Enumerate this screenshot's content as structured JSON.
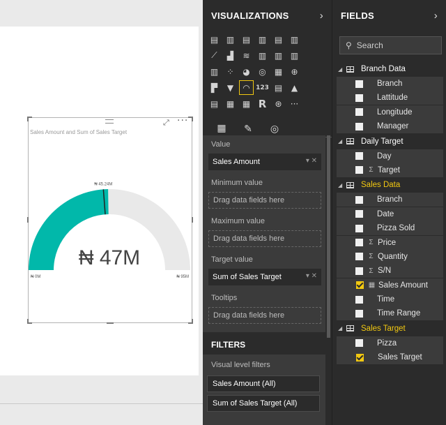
{
  "visual": {
    "title": "Sales Amount and Sum of Sales Target",
    "focus_icon": "focus-mode-icon",
    "more_icon": "more-options-icon"
  },
  "chart_data": {
    "type": "gauge",
    "value": 47,
    "value_label": "₦ 47M",
    "min": 0,
    "max": 95,
    "min_label": "₦ 0M",
    "max_label": "₦ 95M",
    "target": 45.24,
    "target_label": "₦ 45.24M",
    "fill_color": "#01b8aa",
    "track_color": "#e9e9e9",
    "target_color": "#222222"
  },
  "viz_pane": {
    "title": "VISUALIZATIONS",
    "chevron": "›",
    "icons": [
      "stacked-bar-icon",
      "stacked-column-icon",
      "clustered-bar-icon",
      "clustered-column-icon",
      "100-bar-icon",
      "100-column-icon",
      "line-chart-icon",
      "area-chart-icon",
      "stacked-area-icon",
      "line-column-icon",
      "line-stacked-column-icon",
      "ribbon-chart-icon",
      "waterfall-icon",
      "scatter-icon",
      "pie-icon",
      "donut-icon",
      "treemap-icon",
      "map-icon",
      "filled-map-icon",
      "funnel-icon",
      "gauge-icon",
      "card-icon",
      "multi-row-card-icon",
      "kpi-icon",
      "slicer-icon",
      "table-icon",
      "matrix-icon",
      "r-visual-icon",
      "globe-icon",
      "more-visuals-icon"
    ],
    "glyphs": [
      "▤",
      "▥",
      "▤",
      "▥",
      "▤",
      "▥",
      "⟋",
      "▟",
      "≋",
      "▥",
      "▥",
      "▥",
      "▥",
      "⁘",
      "◕",
      "◎",
      "▦",
      "⊕",
      "▛",
      "▼",
      "◠",
      "123",
      "▤",
      "▲",
      "▤",
      "▦",
      "▦",
      "R",
      "⊛",
      "···"
    ],
    "selected_index": 20,
    "tabs": [
      "fields-tab-icon",
      "format-tab-icon",
      "analytics-tab-icon"
    ],
    "tab_glyphs": [
      "▦",
      "✎",
      "◎"
    ],
    "wells": {
      "value_label": "Value",
      "value_field": "Sales Amount",
      "min_label": "Minimum value",
      "min_placeholder": "Drag data fields here",
      "max_label": "Maximum value",
      "max_placeholder": "Drag data fields here",
      "target_label": "Target value",
      "target_field": "Sum of Sales Target",
      "tooltips_label": "Tooltips",
      "tooltips_placeholder": "Drag data fields here",
      "field_ctrl": "▾ ✕"
    },
    "filters": {
      "title": "FILTERS",
      "visual_level_label": "Visual level filters",
      "items": [
        "Sales Amount (All)",
        "Sum of Sales Target (All)"
      ]
    }
  },
  "fields_pane": {
    "title": "FIELDS",
    "chevron": "›",
    "search_placeholder": "Search",
    "search_glyph": "⚲",
    "tables": [
      {
        "name": "Branch Data",
        "active": false,
        "fields": [
          {
            "name": "Branch",
            "sigma": false,
            "checked": false
          },
          {
            "name": "Lattitude",
            "sigma": false,
            "checked": false
          },
          {
            "name": "Longitude",
            "sigma": false,
            "checked": false
          },
          {
            "name": "Manager",
            "sigma": false,
            "checked": false
          }
        ]
      },
      {
        "name": "Daily Target",
        "active": false,
        "fields": [
          {
            "name": "Day",
            "sigma": false,
            "checked": false
          },
          {
            "name": "Target",
            "sigma": true,
            "checked": false
          }
        ]
      },
      {
        "name": "Sales Data",
        "active": true,
        "fields": [
          {
            "name": "Branch",
            "sigma": false,
            "checked": false
          },
          {
            "name": "Date",
            "sigma": false,
            "checked": false
          },
          {
            "name": "Pizza Sold",
            "sigma": false,
            "checked": false
          },
          {
            "name": "Price",
            "sigma": true,
            "checked": false
          },
          {
            "name": "Quantity",
            "sigma": true,
            "checked": false
          },
          {
            "name": "S/N",
            "sigma": true,
            "checked": false
          },
          {
            "name": "Sales Amount",
            "sigma": false,
            "calc": true,
            "checked": true
          },
          {
            "name": "Time",
            "sigma": false,
            "checked": false
          },
          {
            "name": "Time Range",
            "sigma": false,
            "checked": false
          }
        ]
      },
      {
        "name": "Sales Target",
        "active": true,
        "fields": [
          {
            "name": "Pizza",
            "sigma": false,
            "checked": false
          },
          {
            "name": "Sales Target",
            "sigma": false,
            "checked": true
          }
        ]
      }
    ]
  }
}
